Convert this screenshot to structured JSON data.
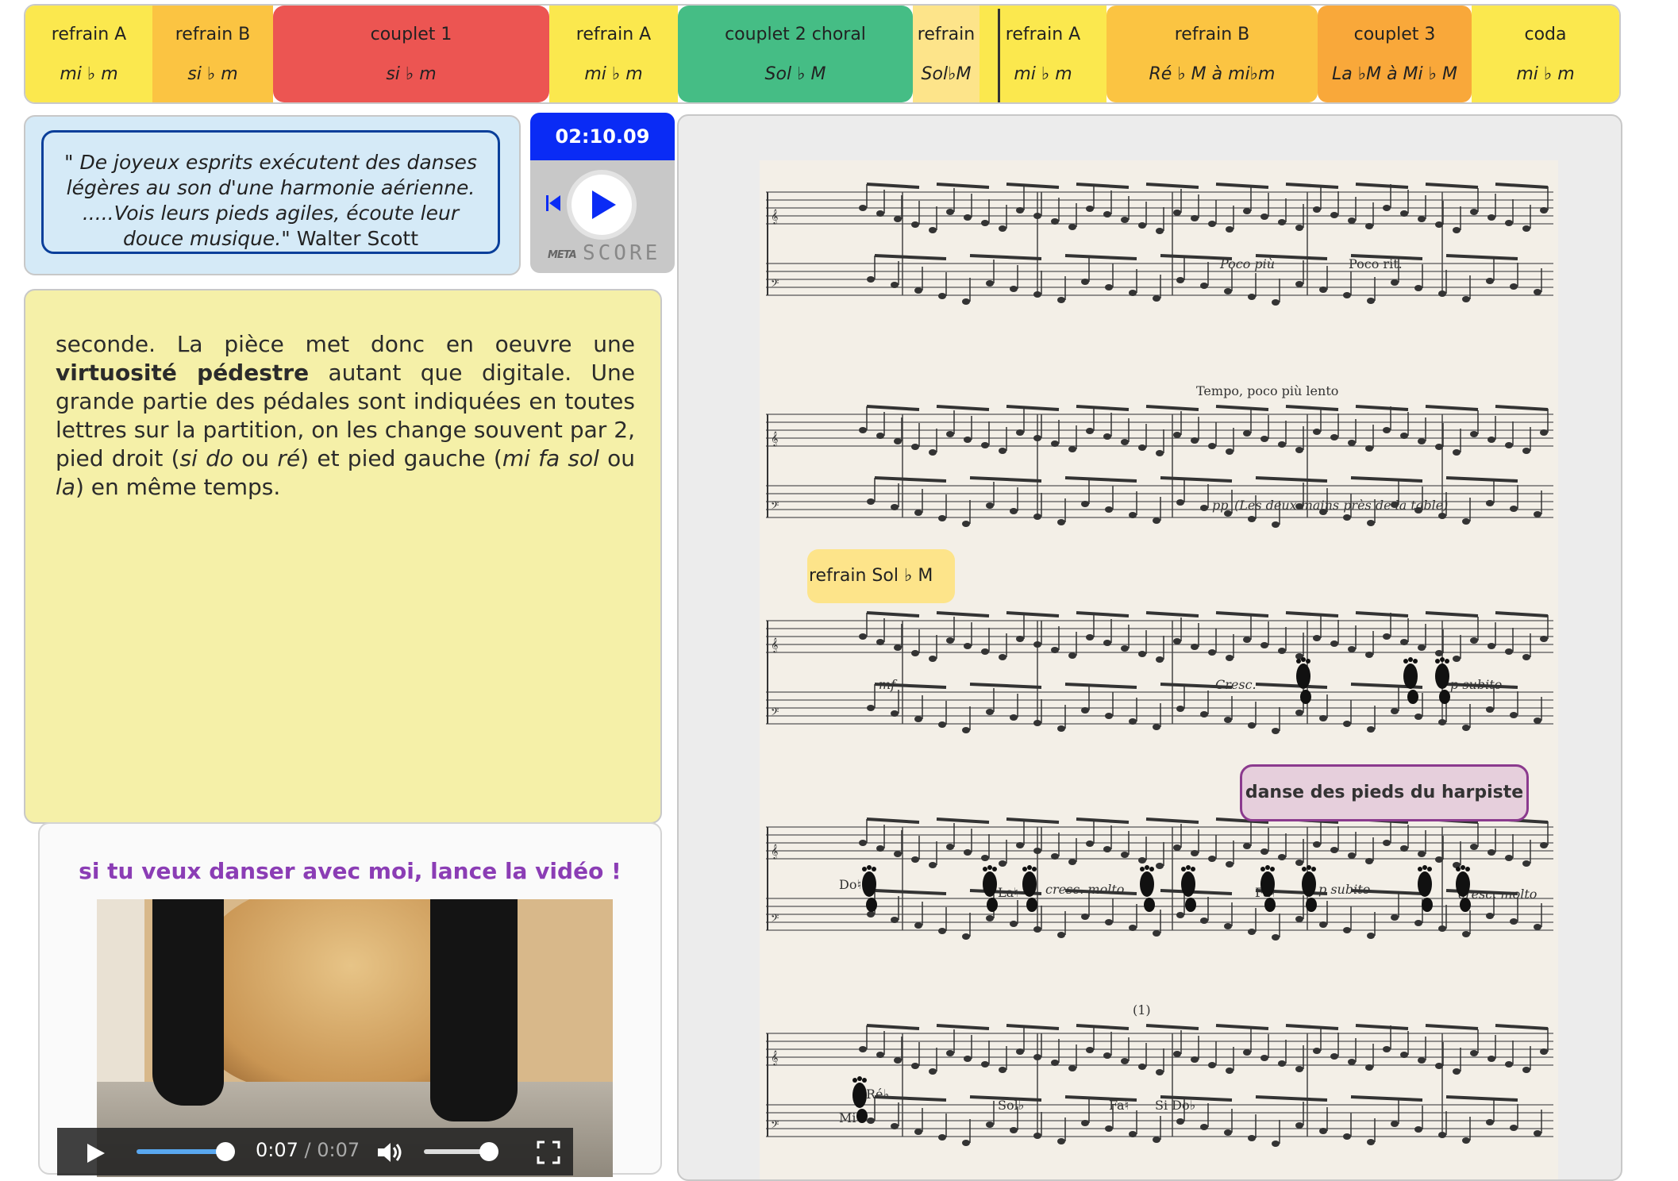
{
  "timeline": {
    "segments": [
      {
        "label": "refrain A",
        "key": "mi ♭ m",
        "color": "#fbe84e"
      },
      {
        "label": "refrain B",
        "key": "si ♭ m",
        "color": "#fbc442"
      },
      {
        "label": "couplet 1",
        "key": "si ♭ m",
        "color": "#ec5552"
      },
      {
        "label": "refrain A",
        "key": "mi ♭ m",
        "color": "#fbe84e"
      },
      {
        "label": "couplet 2 choral",
        "key": "Sol ♭ M",
        "color": "#45bd85"
      },
      {
        "label": "refrain",
        "key": "Sol♭M",
        "color": "#fde48a"
      },
      {
        "label": "refrain A",
        "key": "mi ♭ m",
        "color": "#fbe84e"
      },
      {
        "label": "refrain B",
        "key": "Ré ♭ M à mi♭m",
        "color": "#fbc442"
      },
      {
        "label": "couplet 3",
        "key": "La ♭M à Mi ♭ M",
        "color": "#f9a83a"
      },
      {
        "label": "coda",
        "key": "mi ♭ m",
        "color": "#fbe84e"
      }
    ]
  },
  "quote": {
    "text": "\" De joyeux esprits exécutent des danses légères au son d'une harmonie aérienne. .....Vois leurs pieds agiles, écoute leur douce musique.\"",
    "author": "Walter Scott"
  },
  "player": {
    "clock": "02:10.09",
    "brand_small": "META",
    "brand_large": "SCORE"
  },
  "text_panel": {
    "p1": "seconde. La pièce met donc en oeuvre une ",
    "bold": "virtuosité pédestre",
    "p2": " autant que digitale. Une grande partie des pédales sont indiquées en toutes lettres sur la partition, on les change souvent par 2, pied droit (",
    "i1": "si do",
    "p3": " ou ",
    "i2": "ré",
    "p4": ") et pied gauche (",
    "i3": "mi fa sol",
    "p5": " ou ",
    "i4": "la",
    "p6": ") en même temps."
  },
  "video": {
    "title": "si tu veux danser avec moi, lance la vidéo !",
    "current_time": "0:07",
    "separator": " / ",
    "duration": "0:07",
    "progress": 1.0,
    "volume": 1.0
  },
  "score": {
    "tags": {
      "refrain": "refrain Sol ♭ M",
      "danse": "danse des pieds du harpiste"
    },
    "markings": {
      "poco_piu": "Poco più",
      "poco_rit": "Poco rit.",
      "tempo": "Tempo, poco più lento",
      "pp": "pp",
      "pp_note": "(Les deux mains près de la table)",
      "mf": "mf",
      "cresc": "Cresc.",
      "p_subito": "p subito",
      "cresc_molto": "cresc. molto",
      "p_subito2": "p subito",
      "cresc_molto2": "cresc. molto",
      "do": "Do♮",
      "la": "La♮",
      "fa": "Fa♮",
      "re_b": "Ré♭",
      "mi": "Mi♮",
      "sol_b": "Sol♭",
      "fa2": "Fa♮",
      "si_dob": "Si Do♭",
      "note_mark": "(1)"
    }
  }
}
